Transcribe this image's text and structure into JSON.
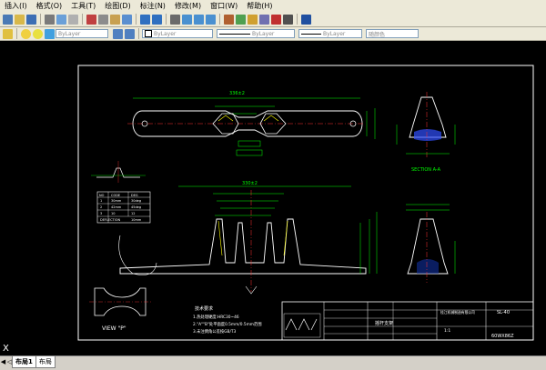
{
  "menu": {
    "items": [
      "插入(I)",
      "格式(O)",
      "工具(T)",
      "绘图(D)",
      "标注(N)",
      "修改(M)",
      "窗口(W)",
      "帮助(H)"
    ]
  },
  "toolbar2": {
    "layer_value": "ByLayer",
    "color_value": "ByLayer",
    "linetype_value": "ByLayer",
    "lineweight_value": "ByLayer",
    "plotstyle_value": "随颜色"
  },
  "drawing": {
    "section_label": "SECTION A-A",
    "view_label": "VIEW \"P\"",
    "dim_top_overall": "336±2",
    "dim_main_width": "330±2",
    "notes_title": "技术要求",
    "notes": [
      "1.热处理硬度:HRC30~46",
      "2.\"A\"\"B\"处平面度0.5mm/0.5mm范围",
      "3.未注倒角公差按GB/T3"
    ],
    "title_block_name": "摇杆支架",
    "title_block_company": "桂江机械制造有限公司",
    "title_block_code": "SL-40",
    "title_block_drawing_no": "60WX86Z",
    "title_block_scale": "1:1",
    "table_header": [
      "NO",
      "CODE",
      "DEG"
    ],
    "table_rows": [
      [
        "1",
        "30mm",
        "30deg"
      ],
      [
        "2",
        "42mm",
        "45deg"
      ],
      [
        "3",
        "10",
        "12"
      ]
    ],
    "table_footer": [
      "DEFLECTION",
      "10mm"
    ]
  },
  "command_marker": "X",
  "layout_tabs": [
    "布局1",
    "布局"
  ]
}
